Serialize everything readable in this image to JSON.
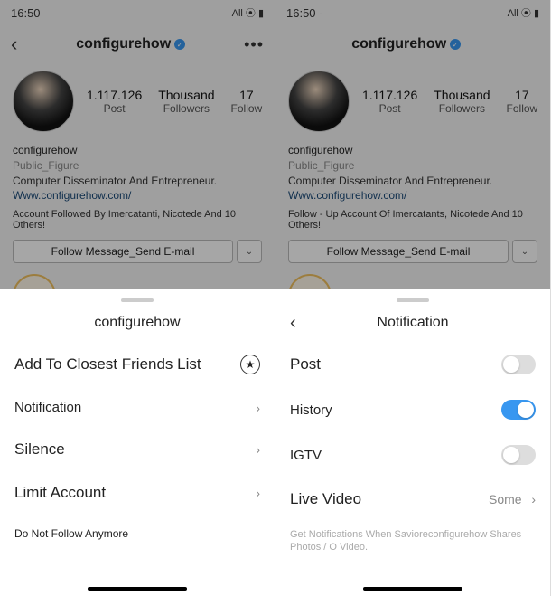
{
  "left": {
    "status": {
      "time": "16:50",
      "right": "All ⦿ ▮"
    },
    "profile": {
      "username": "configurehow",
      "posts_num": "1.117.126",
      "posts_label": "Post",
      "followers_num": "Thousand",
      "followers_label": "Followers",
      "following_num": "17",
      "following_label": "Follow",
      "name": "configurehow",
      "category": "Public_Figure",
      "desc": "Computer Disseminator And Entrepreneur.",
      "link": "Www.configurehow.com/",
      "followed_by": "Account Followed By Imercatanti, Nicotede And 10 Others!",
      "btn1": "Follow Message_Send E-mail"
    },
    "sheet": {
      "title": "configurehow",
      "add_friends": "Add To Closest Friends List",
      "notifications": "Notification",
      "silence": "Silence",
      "limit": "Limit Account",
      "unfollow": "Do Not Follow Anymore"
    }
  },
  "right": {
    "status": {
      "time": "16:50 -",
      "right": "All ⦿ ▮"
    },
    "profile": {
      "username": "configurehow",
      "posts_num": "1.117.126",
      "posts_label": "Post",
      "followers_num": "Thousand",
      "followers_label": "Followers",
      "following_num": "17",
      "following_label": "Follow",
      "name": "configurehow",
      "category": "Public_Figure",
      "desc": "Computer Disseminator And Entrepreneur.",
      "link": "Www.configurehow.com/",
      "followed_by": "Follow - Up Account Of Imercatants, Nicotede And 10 Others!",
      "btn1": "Follow Message_Send E-mail"
    },
    "sheet": {
      "title": "Notification",
      "post": "Post",
      "history": "History",
      "igtv": "IGTV",
      "live": "Live Video",
      "live_val": "Some",
      "note": "Get Notifications When Savioreconfigurehow Shares Photos / O Video."
    }
  }
}
